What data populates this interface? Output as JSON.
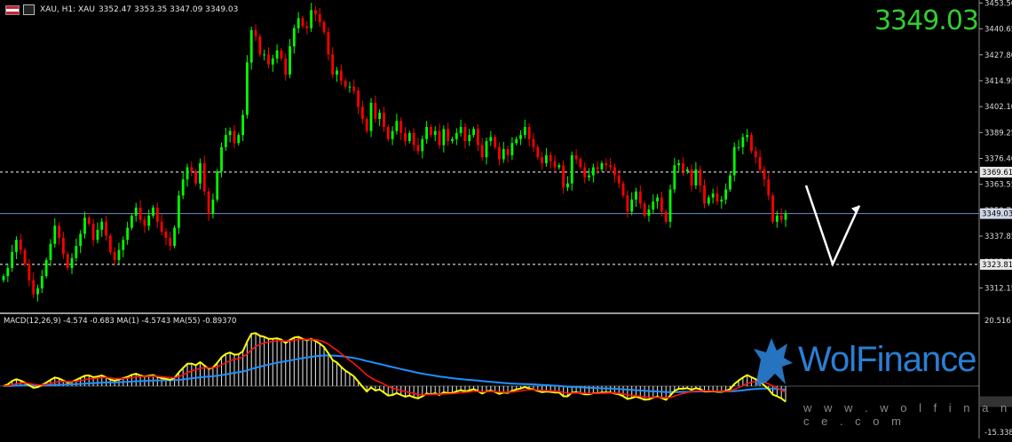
{
  "header": {
    "symbol_line": "XAU, H1:  XAU",
    "ohlc": "3352.47 3353.35 3347.09 3349.03"
  },
  "current_price_big": "3349.03",
  "macd_header": "MACD(12,26,9) -4.574 -0.683 MA(1) -4.5743 MA(55) -0.89370",
  "logo": {
    "text": "WolFinance",
    "url": "w w w . w o l f i n a n c e . c o m"
  },
  "colors": {
    "bull": "#00ff00",
    "bear": "#ff0000",
    "macd_main": "#ffff00",
    "signal": "#ff1010",
    "ma55": "#1e90ff",
    "level_line": "#ffffff",
    "price_line": "#6b8cc4",
    "big_price": "#32cd32",
    "logo": "#2a7fd4"
  },
  "chart_data": {
    "type": "candlestick",
    "price_axis": {
      "ylim": [
        3300.0,
        3455.0
      ],
      "ticks": [
        "3453.50",
        "3440.65",
        "3427.80",
        "3414.95",
        "3402.10",
        "3389.25",
        "3376.40",
        "3363.55",
        "3350.70",
        "3337.85",
        "3325.00",
        "3312.15"
      ]
    },
    "levels": [
      {
        "name": "resistance",
        "value": 3369.61,
        "label": "3369.61"
      },
      {
        "name": "current",
        "value": 3349.03,
        "label": "3349.03"
      },
      {
        "name": "support",
        "value": 3323.81,
        "label": "3323.81"
      }
    ],
    "closes": [
      3318,
      3322,
      3330,
      3336,
      3331,
      3324,
      3316,
      3309,
      3312,
      3318,
      3326,
      3334,
      3343,
      3337,
      3329,
      3322,
      3327,
      3333,
      3339,
      3347,
      3344,
      3336,
      3341,
      3345,
      3338,
      3330,
      3326,
      3331,
      3336,
      3342,
      3348,
      3352,
      3346,
      3343,
      3348,
      3352,
      3345,
      3340,
      3337,
      3333,
      3342,
      3358,
      3366,
      3372,
      3370,
      3364,
      3374,
      3360,
      3349,
      3356,
      3370,
      3382,
      3388,
      3390,
      3384,
      3388,
      3398,
      3424,
      3440,
      3437,
      3428,
      3428,
      3423,
      3426,
      3430,
      3426,
      3418,
      3432,
      3441,
      3446,
      3442,
      3441,
      3450,
      3448,
      3444,
      3439,
      3428,
      3418,
      3420,
      3415,
      3412,
      3412,
      3410,
      3402,
      3396,
      3390,
      3404,
      3396,
      3399,
      3392,
      3386,
      3390,
      3395,
      3389,
      3385,
      3389,
      3383,
      3380,
      3386,
      3392,
      3388,
      3390,
      3383,
      3391,
      3385,
      3386,
      3389,
      3392,
      3385,
      3388,
      3391,
      3383,
      3377,
      3385,
      3387,
      3382,
      3376,
      3381,
      3378,
      3384,
      3386,
      3388,
      3392,
      3386,
      3382,
      3377,
      3374,
      3378,
      3375,
      3372,
      3373,
      3362,
      3364,
      3378,
      3376,
      3372,
      3367,
      3368,
      3372,
      3371,
      3374,
      3373,
      3372,
      3368,
      3364,
      3358,
      3350,
      3356,
      3360,
      3354,
      3348,
      3351,
      3355,
      3357,
      3350,
      3345,
      3361,
      3373,
      3374,
      3370,
      3371,
      3363,
      3371,
      3363,
      3354,
      3357,
      3359,
      3355,
      3356,
      3361,
      3368,
      3382,
      3382,
      3387,
      3388,
      3380,
      3377,
      3371,
      3366,
      3358,
      3345,
      3348,
      3346,
      3349
    ],
    "annotations": [
      {
        "type": "arrow-path",
        "points_price": [
          [
            3363.0
          ],
          [
            3324.0
          ],
          [
            3353.0
          ]
        ]
      }
    ],
    "macd_axis": {
      "ylim": [
        -15.338,
        20.516
      ],
      "ticks": [
        "20.516",
        "-15.338"
      ]
    },
    "macd": [
      0,
      0.5,
      1.5,
      2,
      1.6,
      1,
      0.2,
      -0.5,
      -0.3,
      0.3,
      1,
      1.8,
      2.5,
      2.2,
      1.6,
      1,
      1.2,
      1.8,
      2.4,
      3,
      3.1,
      2.6,
      2.8,
      3.1,
      2.6,
      1.9,
      1.6,
      1.9,
      2.3,
      2.7,
      3.3,
      3.6,
      3.1,
      2.8,
      3,
      3.2,
      2.7,
      2.3,
      2.1,
      1.8,
      2.4,
      4,
      5.3,
      6.5,
      6.6,
      6.1,
      7,
      6,
      5,
      5.4,
      6.8,
      8.4,
      9.4,
      9.8,
      9.2,
      9.3,
      10.2,
      13,
      15.3,
      15.5,
      14.7,
      14.4,
      13.8,
      13.8,
      14,
      13.6,
      12.6,
      13.5,
      14.2,
      14.4,
      13.8,
      13.4,
      13.8,
      13.2,
      12.4,
      11.4,
      9.6,
      7.6,
      6.9,
      5.6,
      4.5,
      3.7,
      2.8,
      1.3,
      -0.2,
      -1.6,
      -0.4,
      -1.3,
      -1,
      -1.9,
      -2.8,
      -2.6,
      -2.1,
      -2.6,
      -3.1,
      -2.8,
      -3.3,
      -3.6,
      -3,
      -2.2,
      -2.4,
      -2.1,
      -2.6,
      -1.8,
      -2.1,
      -2,
      -1.6,
      -1.2,
      -1.6,
      -1.3,
      -0.9,
      -1.5,
      -2.2,
      -1.6,
      -1.3,
      -1.7,
      -2.3,
      -1.9,
      -2,
      -1.4,
      -1,
      -0.7,
      -0.3,
      -0.7,
      -1,
      -1.4,
      -1.8,
      -1.6,
      -1.7,
      -1.9,
      -1.9,
      -3,
      -3,
      -1.9,
      -1.8,
      -2.1,
      -2.4,
      -2.4,
      -2.1,
      -2.1,
      -1.9,
      -1.9,
      -1.9,
      -2.2,
      -2.4,
      -3,
      -3.8,
      -3.5,
      -3.1,
      -3.5,
      -4,
      -3.9,
      -3.4,
      -3.1,
      -3.5,
      -4,
      -2.8,
      -1.4,
      -0.8,
      -0.8,
      -0.6,
      -1.1,
      -0.6,
      -0.9,
      -1.6,
      -1.6,
      -1.5,
      -1.7,
      -1.7,
      -1.4,
      -0.9,
      0.6,
      1.6,
      2.5,
      3.2,
      2.6,
      2,
      1.2,
      0.2,
      -0.9,
      -2.5,
      -3,
      -3.6,
      -4.57
    ],
    "zero_line": 0
  }
}
